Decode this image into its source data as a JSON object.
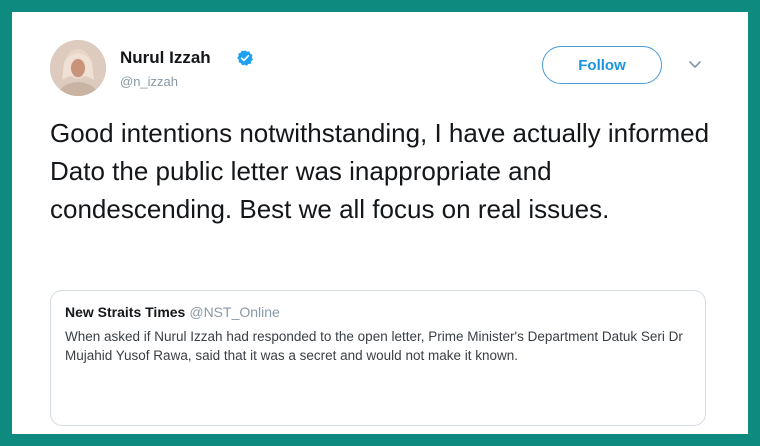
{
  "author": {
    "name": "Nurul Izzah",
    "handle": "@n_izzah",
    "verified": true
  },
  "follow_label": "Follow",
  "tweet_text": "Good intentions notwithstanding, I have actually informed Dato the public letter was inappropriate and condescending. Best we all focus on real issues.",
  "quoted_tweet": {
    "name": "New Straits Times",
    "handle": "@NST_Online",
    "text": "When asked if Nurul Izzah had responded to the open letter, Prime Minister's Department Datuk Seri Dr Mujahid Yusof Rawa, said that it was a secret and would not make it known."
  },
  "colors": {
    "frame": "#0f8a7e",
    "follow_blue": "#1b95e0",
    "verified_blue": "#1da1f2",
    "text": "#14171a",
    "muted": "#8899a6"
  },
  "icons": {
    "verified": "verified-badge-icon",
    "caret": "chevron-down-icon"
  }
}
